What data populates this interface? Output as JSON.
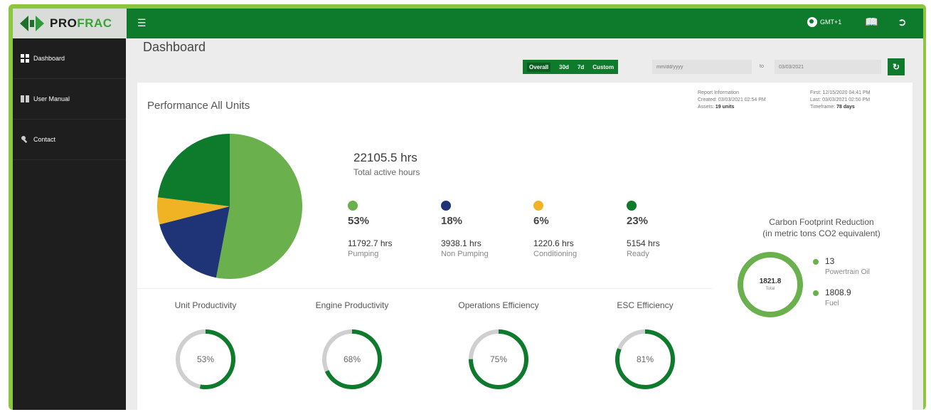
{
  "brand": {
    "logo_pro": "PRO",
    "logo_frac": "FRAC"
  },
  "header": {
    "timezone": "GMT+1"
  },
  "sidebar": {
    "items": [
      {
        "label": "Dashboard",
        "icon": "dashboard-icon"
      },
      {
        "label": "User Manual",
        "icon": "book-icon"
      },
      {
        "label": "Contact",
        "icon": "wrench-icon"
      }
    ]
  },
  "page": {
    "title": "Dashboard"
  },
  "filters": {
    "ranges": [
      "Overall",
      "30d",
      "7d",
      "Custom"
    ],
    "active_range": "Overall",
    "from_placeholder": "mm/dd/yyyy",
    "to_label": "to",
    "to_value": "03/03/2021"
  },
  "card": {
    "title": "Performance All Units"
  },
  "report": {
    "heading": "Report Information",
    "created_label": "Created:",
    "created_value": "03/03/2021 02:54 PM",
    "assets_label": "Assets:",
    "assets_value": "19 units",
    "first_label": "First:",
    "first_value": "12/15/2020 04:41 PM",
    "last_label": "Last:",
    "last_value": "03/03/2021 02:50 PM",
    "timeframe_label": "Timeframe:",
    "timeframe_value": "78 days"
  },
  "totals": {
    "value": "22105.5 hrs",
    "label": "Total active hours"
  },
  "stats": [
    {
      "pct": "53%",
      "hours": "11792.7 hrs",
      "label": "Pumping",
      "color": "#6ab04c"
    },
    {
      "pct": "18%",
      "hours": "3938.1 hrs",
      "label": "Non Pumping",
      "color": "#1f3477"
    },
    {
      "pct": "6%",
      "hours": "1220.6 hrs",
      "label": "Conditioning",
      "color": "#f0b323"
    },
    {
      "pct": "23%",
      "hours": "5154 hrs",
      "label": "Ready",
      "color": "#0e7a2b"
    }
  ],
  "chart_data": {
    "type": "pie",
    "categories": [
      "Pumping",
      "Non Pumping",
      "Conditioning",
      "Ready"
    ],
    "values": [
      53,
      18,
      6,
      23
    ],
    "colors": [
      "#6ab04c",
      "#1f3477",
      "#f0b323",
      "#0e7a2b"
    ]
  },
  "gauges": [
    {
      "title": "Unit Productivity",
      "value_label": "53%",
      "value": 0.53
    },
    {
      "title": "Engine Productivity",
      "value_label": "68%",
      "value": 0.68
    },
    {
      "title": "Operations Efficiency",
      "value_label": "75%",
      "value": 0.75
    },
    {
      "title": "ESC Efficiency",
      "value_label": "81%",
      "value": 0.81
    }
  ],
  "carbon": {
    "title_line1": "Carbon Footprint Reduction",
    "title_line2": "(in metric tons CO2 equivalent)",
    "total": "1821.8",
    "total_label": "Total",
    "items": [
      {
        "value": "13",
        "label": "Powertrain Oil"
      },
      {
        "value": "1808.9",
        "label": "Fuel"
      }
    ]
  },
  "colors": {
    "brand_green": "#0e7a2b",
    "light_green": "#6ab04c",
    "frame_green": "#8cc63f"
  }
}
